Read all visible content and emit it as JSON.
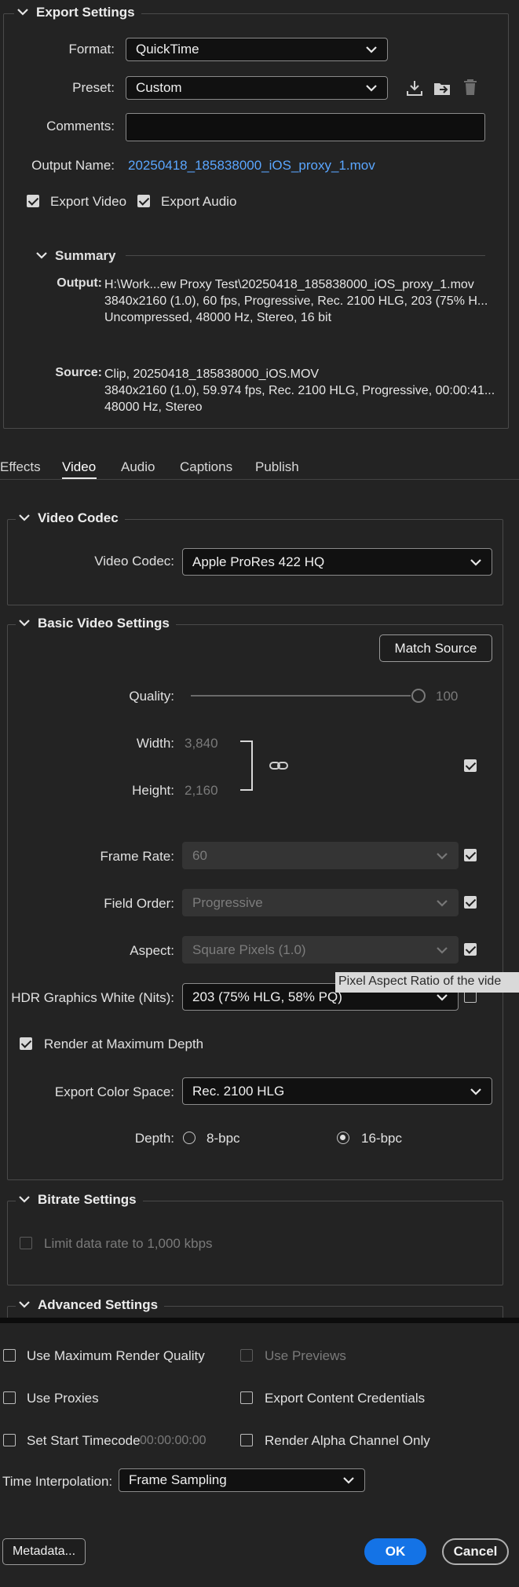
{
  "export_settings": {
    "title": "Export Settings",
    "format_label": "Format:",
    "format_value": "QuickTime",
    "preset_label": "Preset:",
    "preset_value": "Custom",
    "comments_label": "Comments:",
    "comments_value": "",
    "output_name_label": "Output Name:",
    "output_name_value": "20250418_185838000_iOS_proxy_1.mov",
    "export_video_label": "Export Video",
    "export_video_checked": true,
    "export_audio_label": "Export Audio",
    "export_audio_checked": true
  },
  "summary": {
    "title": "Summary",
    "output_label": "Output:",
    "output_lines": [
      "H:\\Work...ew Proxy Test\\20250418_185838000_iOS_proxy_1.mov",
      "3840x2160 (1.0), 60 fps, Progressive, Rec. 2100 HLG, 203 (75% H...",
      "Uncompressed, 48000 Hz, Stereo, 16 bit"
    ],
    "source_label": "Source:",
    "source_lines": [
      "Clip, 20250418_185838000_iOS.MOV",
      "3840x2160 (1.0), 59.974 fps, Rec. 2100 HLG, Progressive, 00:00:41...",
      "48000 Hz, Stereo"
    ]
  },
  "tabs": {
    "effects": "Effects",
    "video": "Video",
    "audio": "Audio",
    "captions": "Captions",
    "publish": "Publish",
    "active": "video"
  },
  "video_codec": {
    "title": "Video Codec",
    "label": "Video Codec:",
    "value": "Apple ProRes 422 HQ"
  },
  "basic_video": {
    "title": "Basic Video Settings",
    "match_source": "Match Source",
    "quality_label": "Quality:",
    "quality_value": "100",
    "width_label": "Width:",
    "width_value": "3,840",
    "height_label": "Height:",
    "height_value": "2,160",
    "frame_rate_label": "Frame Rate:",
    "frame_rate_value": "60",
    "field_order_label": "Field Order:",
    "field_order_value": "Progressive",
    "aspect_label": "Aspect:",
    "aspect_value": "Square Pixels (1.0)",
    "tooltip": "Pixel Aspect Ratio of the vide",
    "hdr_label": "HDR Graphics White (Nits):",
    "hdr_value": "203 (75% HLG, 58% PQ)",
    "render_max_depth_label": "Render at Maximum Depth",
    "color_space_label": "Export Color Space:",
    "color_space_value": "Rec. 2100 HLG",
    "depth_label": "Depth:",
    "depth_8": "8-bpc",
    "depth_16": "16-bpc"
  },
  "bitrate": {
    "title": "Bitrate Settings",
    "limit_label": "Limit data rate to 1,000 kbps"
  },
  "advanced": {
    "title": "Advanced Settings"
  },
  "bottom": {
    "max_render_quality": "Use Maximum Render Quality",
    "use_previews": "Use Previews",
    "use_proxies": "Use Proxies",
    "export_credentials": "Export Content Credentials",
    "set_start_timecode": "Set Start Timecode",
    "timecode_value": "00:00:00:00",
    "render_alpha": "Render Alpha Channel Only",
    "time_interp_label": "Time Interpolation:",
    "time_interp_value": "Frame Sampling",
    "metadata_button": "Metadata...",
    "ok_button": "OK",
    "cancel_button": "Cancel"
  },
  "colors": {
    "background": "#232323",
    "accent": "#1473e6",
    "link": "#5aa6ff"
  }
}
